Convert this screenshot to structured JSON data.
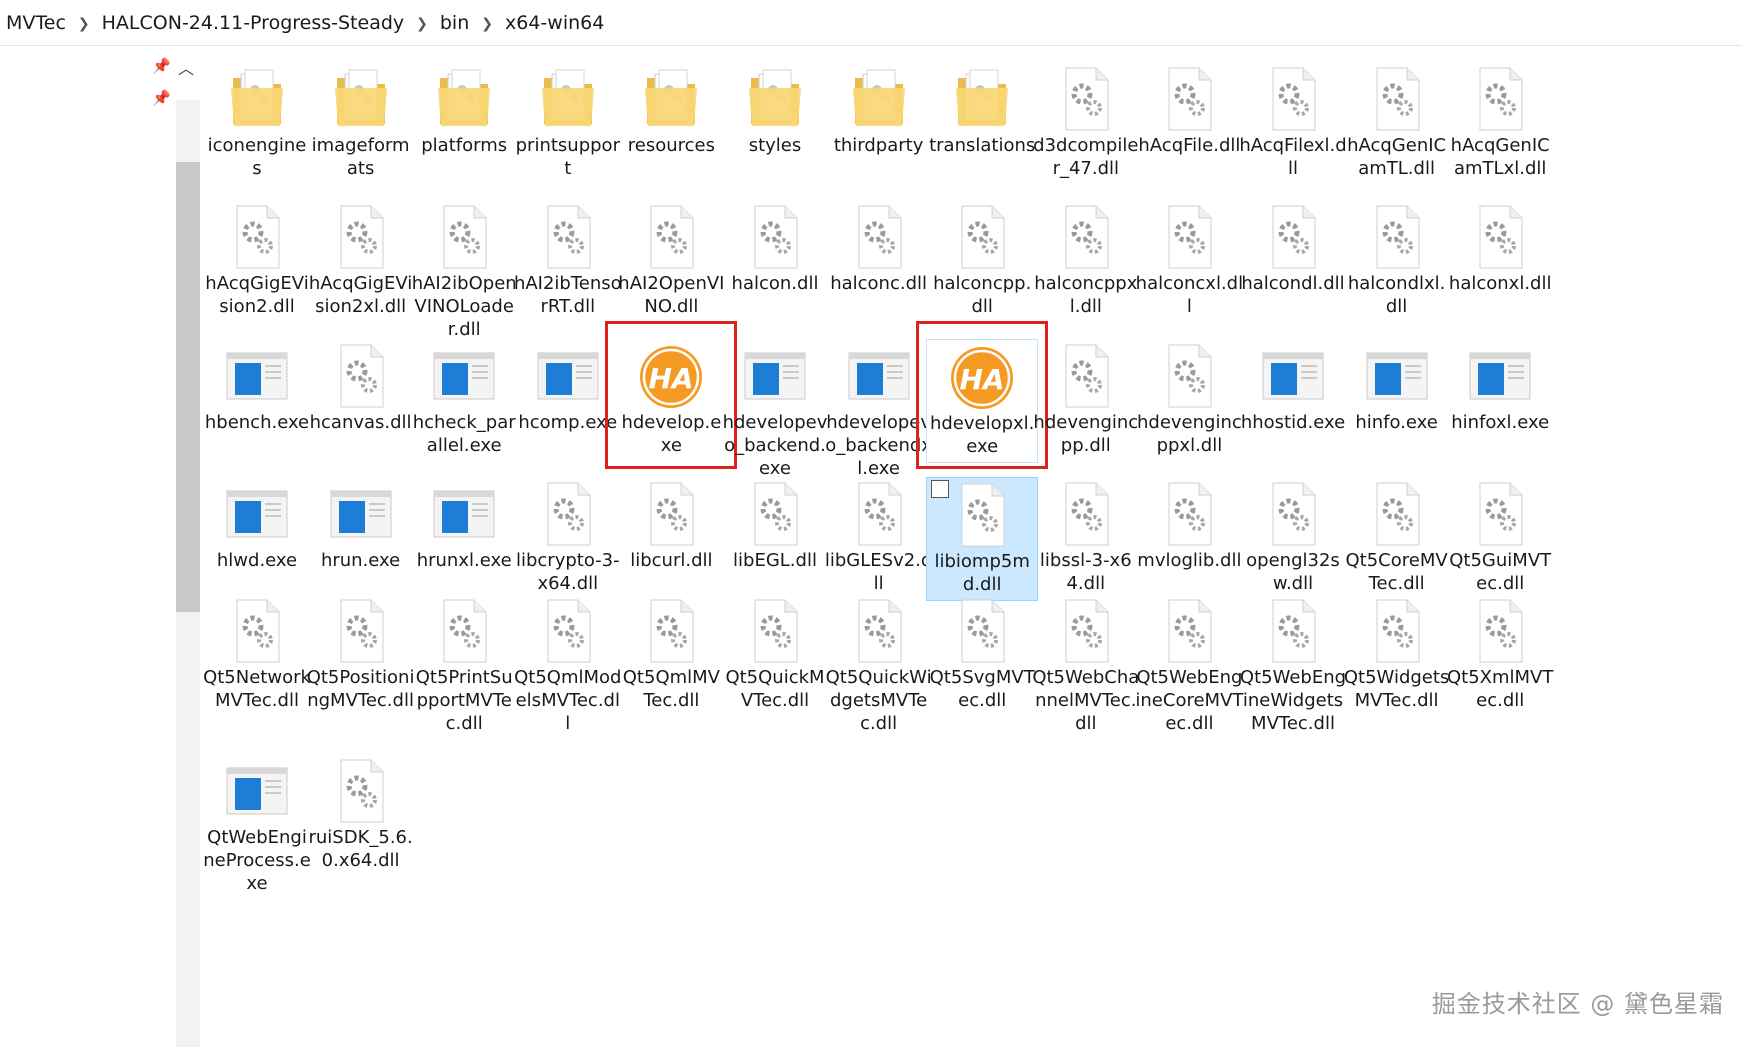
{
  "breadcrumb": [
    "MVTec",
    "HALCON-24.11-Progress-Steady",
    "bin",
    "x64-win64"
  ],
  "colors": {
    "highlight_box": "#e0201c",
    "selection_bg": "#cce8ff",
    "halcon_orange": "#f59a23",
    "exe_blue": "#1e7ed6"
  },
  "files": [
    {
      "name": "iconengines",
      "type": "folder"
    },
    {
      "name": "imageformats",
      "type": "folder"
    },
    {
      "name": "platforms",
      "type": "folder"
    },
    {
      "name": "printsupport",
      "type": "folder"
    },
    {
      "name": "resources",
      "type": "folder"
    },
    {
      "name": "styles",
      "type": "folder"
    },
    {
      "name": "thirdparty",
      "type": "folder"
    },
    {
      "name": "translations",
      "type": "folder"
    },
    {
      "name": "d3dcompiler_47.dll",
      "type": "dll"
    },
    {
      "name": "hAcqFile.dll",
      "type": "dll"
    },
    {
      "name": "hAcqFilexl.dll",
      "type": "dll"
    },
    {
      "name": "hAcqGenICamTL.dll",
      "type": "dll"
    },
    {
      "name": "hAcqGenICamTLxl.dll",
      "type": "dll"
    },
    {
      "name": "hAcqGigEVision2.dll",
      "type": "dll"
    },
    {
      "name": "hAcqGigEVision2xl.dll",
      "type": "dll"
    },
    {
      "name": "hAI2ibOpenVINOLoader.dll",
      "type": "dll"
    },
    {
      "name": "hAI2ibTensorRT.dll",
      "type": "dll"
    },
    {
      "name": "hAI2OpenVINO.dll",
      "type": "dll"
    },
    {
      "name": "halcon.dll",
      "type": "dll"
    },
    {
      "name": "halconc.dll",
      "type": "dll"
    },
    {
      "name": "halconcpp.dll",
      "type": "dll"
    },
    {
      "name": "halconcppxl.dll",
      "type": "dll"
    },
    {
      "name": "halconcxl.dll",
      "type": "dll"
    },
    {
      "name": "halcondl.dll",
      "type": "dll"
    },
    {
      "name": "halcondlxl.dll",
      "type": "dll"
    },
    {
      "name": "halconxl.dll",
      "type": "dll"
    },
    {
      "name": "hbench.exe",
      "type": "exe"
    },
    {
      "name": "hcanvas.dll",
      "type": "dll"
    },
    {
      "name": "hcheck_parallel.exe",
      "type": "exe"
    },
    {
      "name": "hcomp.exe",
      "type": "exe"
    },
    {
      "name": "hdevelop.exe",
      "type": "halcon",
      "badge": "HA",
      "highlighted": true
    },
    {
      "name": "hdevelopevo_backend.exe",
      "type": "exe"
    },
    {
      "name": "hdevelopevo_backendxl.exe",
      "type": "exe"
    },
    {
      "name": "hdevelopxl.exe",
      "type": "halcon",
      "badge": "HA",
      "highlighted": true,
      "hover": true
    },
    {
      "name": "hdevengincpp.dll",
      "type": "dll"
    },
    {
      "name": "hdevengincppxl.dll",
      "type": "dll"
    },
    {
      "name": "hhostid.exe",
      "type": "exe"
    },
    {
      "name": "hinfo.exe",
      "type": "exe"
    },
    {
      "name": "hinfoxl.exe",
      "type": "exe"
    },
    {
      "name": "hlwd.exe",
      "type": "exe"
    },
    {
      "name": "hrun.exe",
      "type": "exe"
    },
    {
      "name": "hrunxl.exe",
      "type": "exe"
    },
    {
      "name": "libcrypto-3-x64.dll",
      "type": "dll"
    },
    {
      "name": "libcurl.dll",
      "type": "dll"
    },
    {
      "name": "libEGL.dll",
      "type": "dll"
    },
    {
      "name": "libGLESv2.dll",
      "type": "dll"
    },
    {
      "name": "libiomp5md.dll",
      "type": "dll",
      "selected": true
    },
    {
      "name": "libssl-3-x64.dll",
      "type": "dll"
    },
    {
      "name": "mvloglib.dll",
      "type": "dll"
    },
    {
      "name": "opengl32sw.dll",
      "type": "dll"
    },
    {
      "name": "Qt5CoreMVTec.dll",
      "type": "dll"
    },
    {
      "name": "Qt5GuiMVTec.dll",
      "type": "dll"
    },
    {
      "name": "Qt5NetworkMVTec.dll",
      "type": "dll"
    },
    {
      "name": "Qt5PositioningMVTec.dll",
      "type": "dll"
    },
    {
      "name": "Qt5PrintSupportMVTec.dll",
      "type": "dll"
    },
    {
      "name": "Qt5QmlModelsMVTec.dll",
      "type": "dll"
    },
    {
      "name": "Qt5QmlMVTec.dll",
      "type": "dll"
    },
    {
      "name": "Qt5QuickMVTec.dll",
      "type": "dll"
    },
    {
      "name": "Qt5QuickWidgetsMVTec.dll",
      "type": "dll"
    },
    {
      "name": "Qt5SvgMVTec.dll",
      "type": "dll"
    },
    {
      "name": "Qt5WebChannelMVTec.dll",
      "type": "dll"
    },
    {
      "name": "Qt5WebEngineCoreMVTec.dll",
      "type": "dll"
    },
    {
      "name": "Qt5WebEngineWidgetsMVTec.dll",
      "type": "dll"
    },
    {
      "name": "Qt5WidgetsMVTec.dll",
      "type": "dll"
    },
    {
      "name": "Qt5XmlMVTec.dll",
      "type": "dll"
    },
    {
      "name": "QtWebEngineProcess.exe",
      "type": "exe"
    },
    {
      "name": "ruiSDK_5.6.0.x64.dll",
      "type": "dll"
    }
  ],
  "watermark": "掘金技术社区 @ 黛色星霜"
}
